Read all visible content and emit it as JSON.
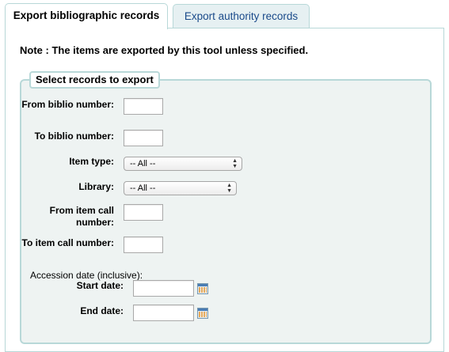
{
  "tabs": [
    {
      "label": "Export bibliographic records",
      "active": true
    },
    {
      "label": "Export authority records",
      "active": false
    }
  ],
  "note": "Note : The items are exported by this tool unless specified.",
  "fieldset": {
    "legend": "Select records to export",
    "from_biblio_label": "From biblio number:",
    "from_biblio_value": "",
    "to_biblio_label": "To biblio number:",
    "to_biblio_value": "",
    "item_type_label": "Item type:",
    "item_type_selected": "-- All --",
    "library_label": "Library:",
    "library_selected": "-- All --",
    "from_callnumber_label": "From item call number:",
    "from_callnumber_value": "",
    "to_callnumber_label": "To item call number:",
    "to_callnumber_value": "",
    "accession_label": "Accession date (inclusive):",
    "start_date_label": "Start date:",
    "start_date_value": "",
    "end_date_label": "End date:",
    "end_date_value": ""
  },
  "colors": {
    "border": "#b8d8d8",
    "fieldset_bg": "#eef3f2",
    "inactive_tab_bg": "#e6f0f2",
    "inactive_tab_text": "#1a4a8a"
  }
}
